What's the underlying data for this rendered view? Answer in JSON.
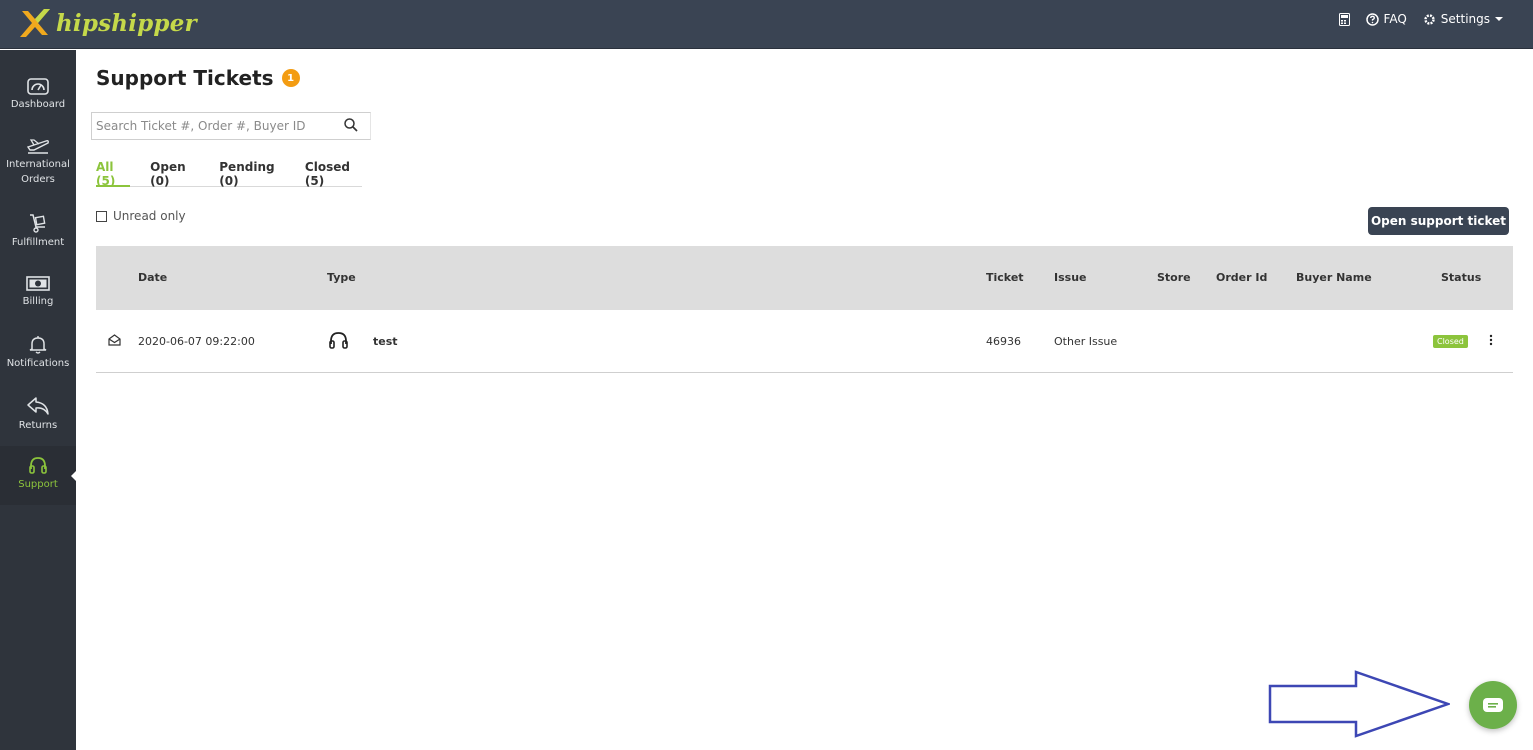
{
  "app": {
    "name": "hipshipper"
  },
  "topnav": {
    "faq": "FAQ",
    "settings": "Settings"
  },
  "sidebar": {
    "items": [
      {
        "label": "Dashboard"
      },
      {
        "label": "International Orders"
      },
      {
        "label": "Fulfillment"
      },
      {
        "label": "Billing"
      },
      {
        "label": "Notifications"
      },
      {
        "label": "Returns"
      },
      {
        "label": "Support",
        "active": true
      }
    ]
  },
  "page": {
    "title": "Support Tickets",
    "badge": "1"
  },
  "search": {
    "placeholder": "Search Ticket #, Order #, Buyer ID",
    "value": ""
  },
  "tabs": [
    {
      "label": "All (5)",
      "active": true
    },
    {
      "label": "Open (0)"
    },
    {
      "label": "Pending (0)"
    },
    {
      "label": "Closed (5)"
    }
  ],
  "filter": {
    "unread_label": "Unread only",
    "checked": false
  },
  "actions": {
    "open_ticket": "Open support ticket"
  },
  "table": {
    "headers": {
      "date": "Date",
      "type": "Type",
      "ticket": "Ticket",
      "issue": "Issue",
      "store": "Store",
      "order_id": "Order Id",
      "buyer_name": "Buyer Name",
      "status": "Status"
    },
    "rows": [
      {
        "date": "2020-06-07 09:22:00",
        "type": "test",
        "ticket": "46936",
        "issue": "Other Issue",
        "store": "",
        "order_id": "",
        "buyer_name": "",
        "status": "Closed"
      }
    ]
  },
  "colors": {
    "topbar": "#3a4453",
    "sidebar": "#2f343c",
    "accent": "#8cc43c",
    "badge": "#f39c12",
    "annotation_arrow": "#3d47b4"
  },
  "icons": [
    "calculator-icon",
    "help-circle-icon",
    "gear-icon",
    "search-icon",
    "headset-icon",
    "envelope-open-icon",
    "kebab-icon",
    "chat-icon"
  ]
}
